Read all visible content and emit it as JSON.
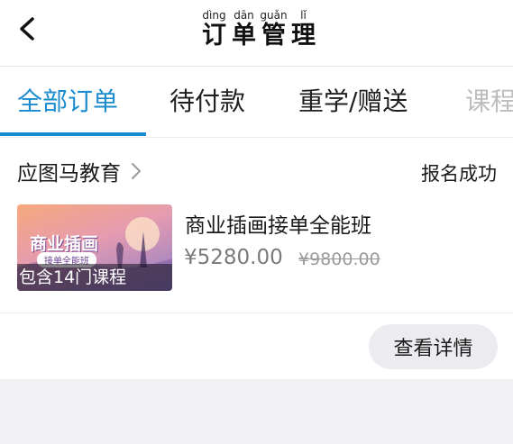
{
  "header": {
    "title_chars": [
      {
        "pinyin": "dìng",
        "hanzi": "订"
      },
      {
        "pinyin": "dān",
        "hanzi": "单"
      },
      {
        "pinyin": "guǎn",
        "hanzi": "管"
      },
      {
        "pinyin": "lǐ",
        "hanzi": "理"
      }
    ]
  },
  "tabs": [
    {
      "label": "全部订单",
      "active": true
    },
    {
      "label": "待付款",
      "active": false
    },
    {
      "label": "重学/赠送",
      "active": false
    },
    {
      "label": "课程",
      "active": false
    }
  ],
  "order": {
    "school": "应图马教育",
    "status": "报名成功",
    "thumbnail": {
      "title": "商业插画",
      "subtitle": "接单全能班",
      "caption": "包含14门课程"
    },
    "course_title": "商业插画接单全能班",
    "price": "¥5280.00",
    "original_price": "¥9800.00",
    "detail_button": "查看详情"
  },
  "colors": {
    "accent": "#1a8ccf",
    "background": "#f1f1f3"
  },
  "icons": {
    "back": "chevron-left-icon",
    "school_arrow": "chevron-right-icon"
  }
}
